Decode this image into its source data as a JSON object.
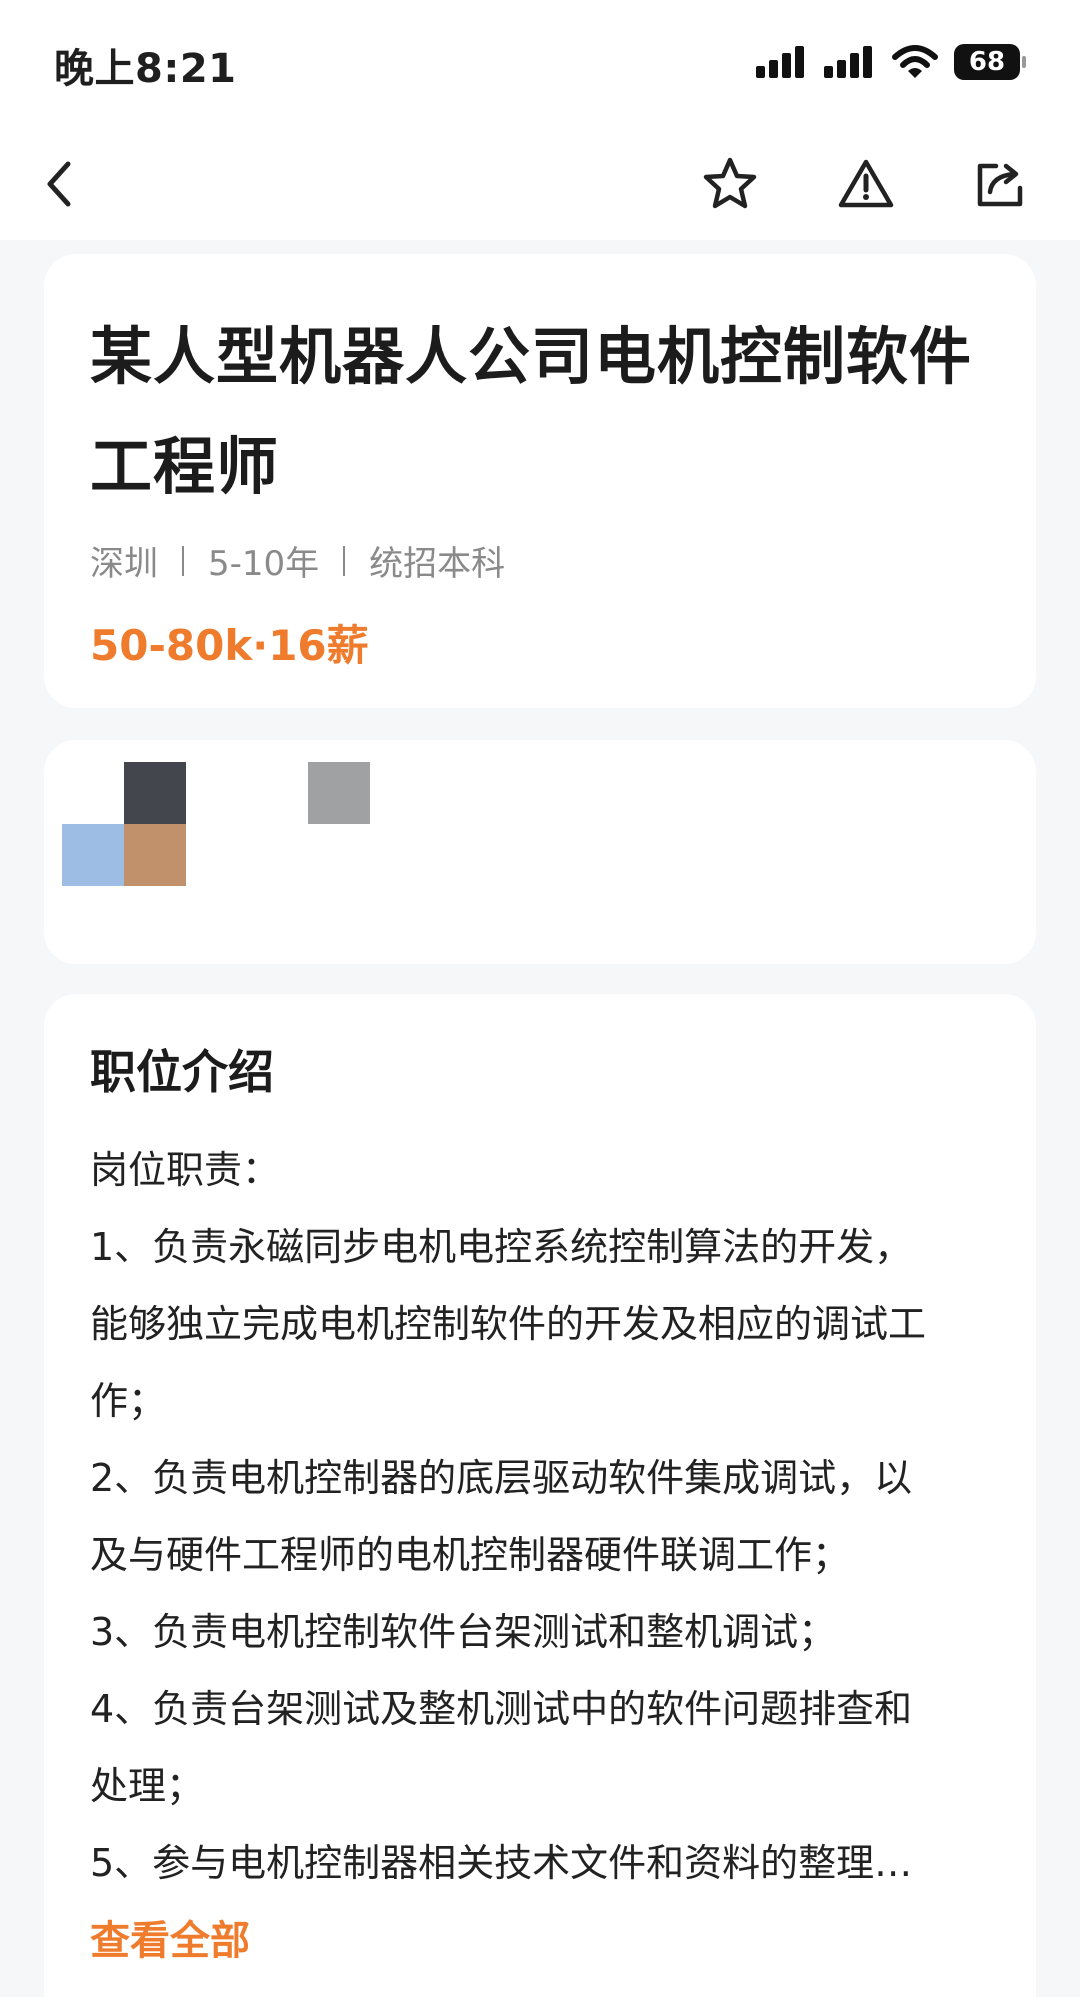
{
  "status_bar": {
    "time": "晚上8:21",
    "battery": "68"
  },
  "nav": {
    "back_icon": "chevron-left-icon",
    "favorite_icon": "star-icon",
    "report_icon": "warning-triangle-icon",
    "share_icon": "share-icon"
  },
  "job": {
    "title": "某人型机器人公司电机控制软件工程师",
    "location": "深圳",
    "experience": "5-10年",
    "education": "统招本科",
    "salary": "50-80k·16薪"
  },
  "colors": {
    "accent": "#ef7c2d",
    "background": "#f6f7f9",
    "card": "#ffffff"
  },
  "description": {
    "section_title": "职位介绍",
    "lines": [
      "岗位职责：",
      "1、负责永磁同步电机电控系统控制算法的开发，",
      "能够独立完成电机控制软件的开发及相应的调试工",
      "作；",
      "2、负责电机控制器的底层驱动软件集成调试，以",
      "及与硬件工程师的电机控制器硬件联调工作；",
      "3、负责电机控制软件台架测试和整机调试；",
      "4、负责台架测试及整机测试中的软件问题排查和",
      "处理；",
      "5、参与电机控制器相关技术文件和资料的整理…"
    ],
    "view_all": "查看全部"
  }
}
